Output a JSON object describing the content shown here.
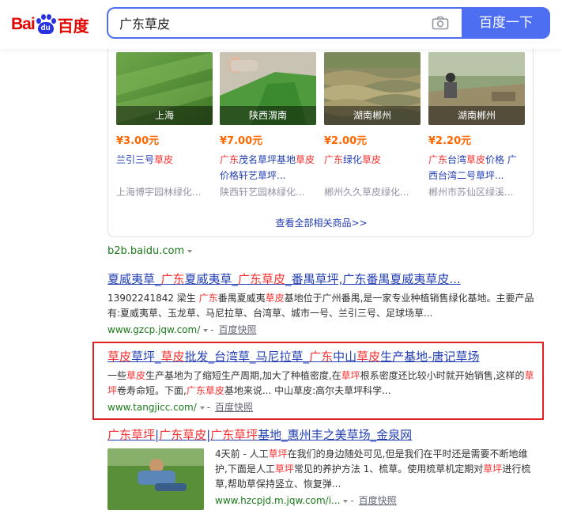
{
  "search": {
    "query": "广东草皮",
    "button_label": "百度一下"
  },
  "logo": {
    "bai": "Bai",
    "du": "du",
    "baidu": "百度"
  },
  "products": [
    {
      "caption": "上海",
      "price": "¥3.00元",
      "title_parts": [
        "兰引三号",
        "草皮"
      ],
      "shop": "上海博宇园林绿化..."
    },
    {
      "caption": "陕西渭南",
      "price": "¥7.00元",
      "title_parts": [
        "广东",
        "茂名草坪基地",
        "草皮",
        "价格",
        "轩艺草坪..."
      ],
      "shop": "陕西轩艺园林绿化..."
    },
    {
      "caption": "湖南郴州",
      "price": "¥2.00元",
      "title_parts": [
        "广东",
        "绿化",
        "草皮"
      ],
      "shop": "郴州久久草皮绿化..."
    },
    {
      "caption": "湖南郴州",
      "price": "¥2.20元",
      "title_parts": [
        "广东",
        "台湾",
        "草皮",
        "价格 广西台湾二号草坪..."
      ],
      "shop": "郴州市苏仙区绿溪..."
    }
  ],
  "more_label": "查看全部相关商品>>",
  "b2b_source": "b2b.baidu.com",
  "results": [
    {
      "title_parts": [
        "夏威夷草_",
        "广东",
        "夏威夷草_",
        "广东草皮",
        "_番禺草坪,",
        "广东",
        "番禺夏威夷草皮..."
      ],
      "abstract_parts": [
        "13902241842 梁生 ",
        "广东",
        "番禺夏威夷",
        "草皮",
        "基地位于广州番禺,是一家专业种植销售绿化基地。主要产品有:夏威夷草、玉龙草、马尼拉草、台湾草、城市一号、兰引三号、足球场草..."
      ],
      "url": "www.gzcp.jqw.com/",
      "snapshot": "百度快照"
    },
    {
      "title_parts": [
        "草皮",
        "草坪_",
        "草皮",
        "批发_台湾草_马尼拉草_",
        "广东",
        "中山",
        "草皮",
        "生产基地-唐记草场"
      ],
      "abstract_parts": [
        "一些",
        "草皮",
        "生产基地为了缩短生产周期,加大了种植密度,在",
        "草坪",
        "根系密度还比较小时就开始销售,这样的",
        "草坪",
        "卷寿命短。下面,",
        "广东草皮",
        "基地来说... 中山草皮:高尔夫草坪科学..."
      ],
      "url": "www.tangjicc.com/",
      "snapshot": "百度快照"
    },
    {
      "title_parts": [
        "广东草坪",
        "|",
        "广东草皮",
        "|",
        "广东草坪",
        "基地_惠州丰之美草场_金泉网"
      ],
      "abstract_parts": [
        "4天前 - 人工",
        "草坪",
        "在我们的身边随处可见,但是我们在平时还是需要不断地维护,下面是人工",
        "草坪",
        "常见的养护方法 1、梳草。使用梳草机定期对",
        "草坪",
        "进行梳草,帮助草保持竖立、恢复弹..."
      ],
      "url": "www.hzcpjd.m.jqw.com/i...",
      "snapshot": "百度快照"
    }
  ],
  "colors": {
    "accent": "#4e6ef2",
    "link": "#2440b3",
    "keyword": "#f73131",
    "url": "#1a7a1a",
    "price": "#ff6600",
    "highlight": "#e02020"
  }
}
